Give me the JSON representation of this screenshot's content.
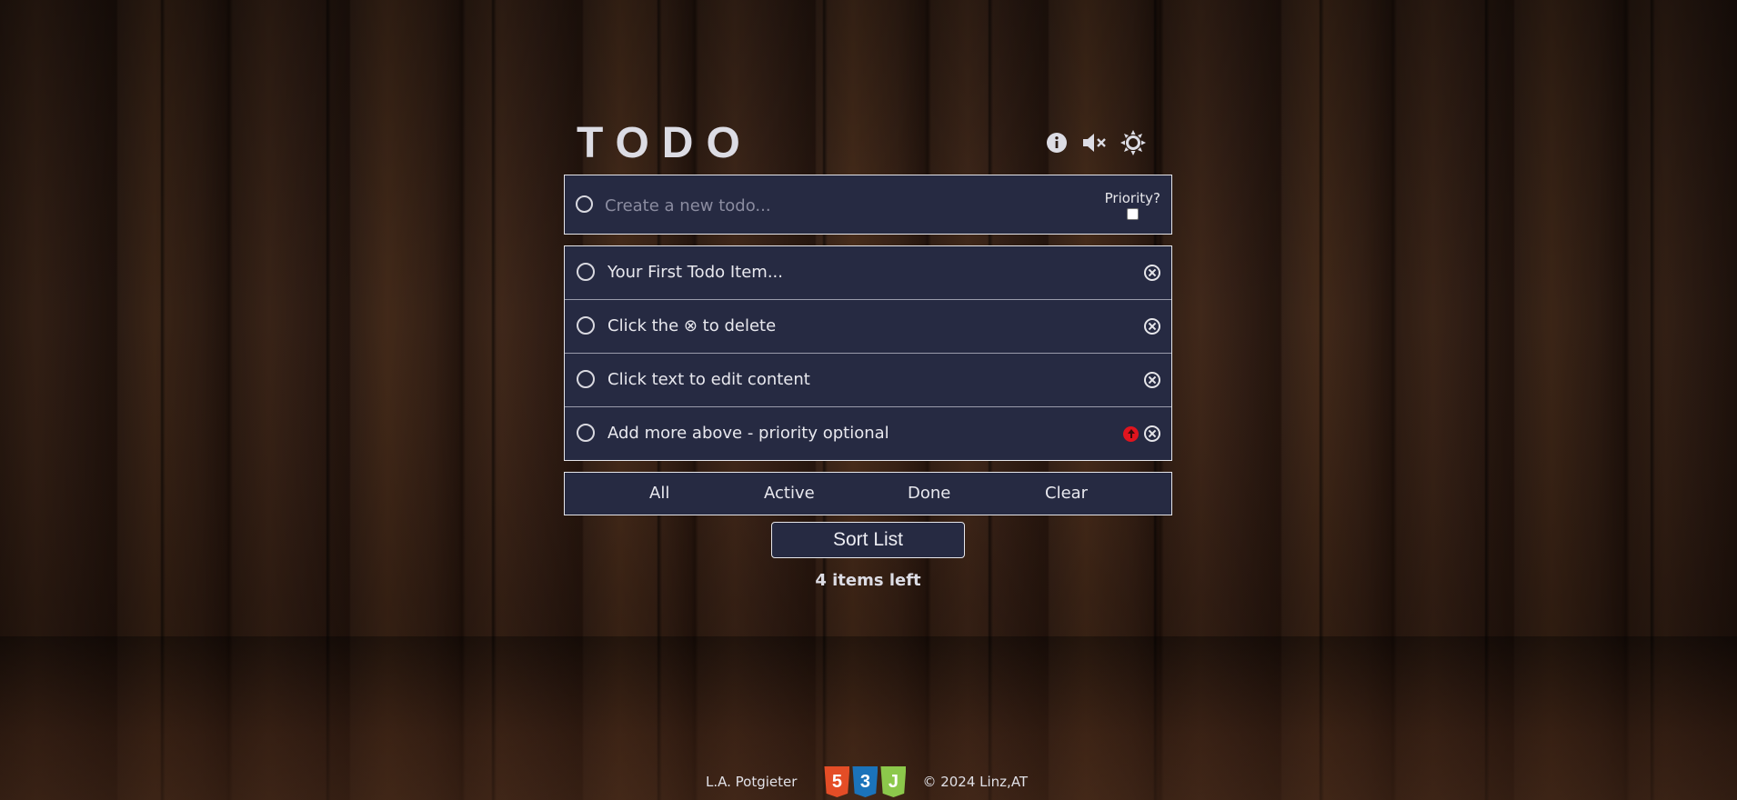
{
  "header": {
    "title": "TODO",
    "icons": [
      "info-icon",
      "mute-icon",
      "sun-icon"
    ]
  },
  "new_todo": {
    "placeholder": "Create a new todo...",
    "priority_label": "Priority?",
    "priority_checked": false
  },
  "todos": [
    {
      "text": "Your First Todo Item...",
      "priority": false
    },
    {
      "text": "Click the ⊗ to delete",
      "priority": false
    },
    {
      "text": "Click text to edit content",
      "priority": false
    },
    {
      "text": "Add more above - priority optional",
      "priority": true
    }
  ],
  "filters": {
    "all": "All",
    "active": "Active",
    "done": "Done",
    "clear": "Clear"
  },
  "sort_label": "Sort List",
  "items_left": "4 items left",
  "footer": {
    "author": "L.A. Potgieter",
    "badges": [
      {
        "label": "5",
        "color": "#e44d26"
      },
      {
        "label": "3",
        "color": "#1b73ba"
      },
      {
        "label": "J",
        "color": "#8cc84b"
      }
    ],
    "copyright": "© 2024 Linz,AT"
  },
  "colors": {
    "panel": "#262a42",
    "border": "#e6e6ea",
    "priority": "#e0141e"
  }
}
